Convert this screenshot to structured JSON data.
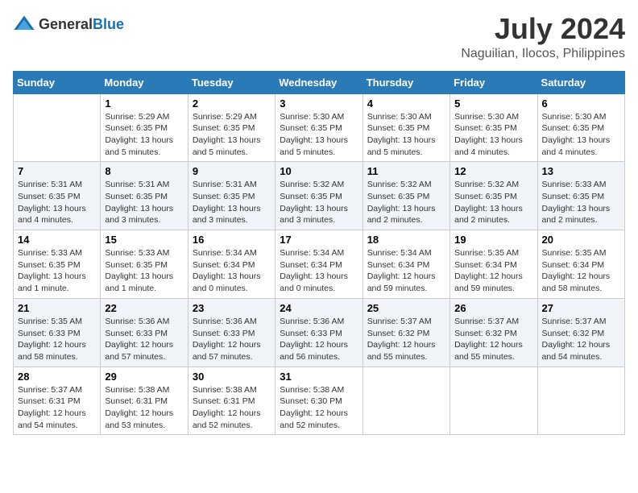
{
  "header": {
    "logo_general": "General",
    "logo_blue": "Blue",
    "month": "July 2024",
    "location": "Naguilian, Ilocos, Philippines"
  },
  "columns": [
    "Sunday",
    "Monday",
    "Tuesday",
    "Wednesday",
    "Thursday",
    "Friday",
    "Saturday"
  ],
  "weeks": [
    [
      {
        "day": "",
        "sunrise": "",
        "sunset": "",
        "daylight": ""
      },
      {
        "day": "1",
        "sunrise": "Sunrise: 5:29 AM",
        "sunset": "Sunset: 6:35 PM",
        "daylight": "Daylight: 13 hours and 5 minutes."
      },
      {
        "day": "2",
        "sunrise": "Sunrise: 5:29 AM",
        "sunset": "Sunset: 6:35 PM",
        "daylight": "Daylight: 13 hours and 5 minutes."
      },
      {
        "day": "3",
        "sunrise": "Sunrise: 5:30 AM",
        "sunset": "Sunset: 6:35 PM",
        "daylight": "Daylight: 13 hours and 5 minutes."
      },
      {
        "day": "4",
        "sunrise": "Sunrise: 5:30 AM",
        "sunset": "Sunset: 6:35 PM",
        "daylight": "Daylight: 13 hours and 5 minutes."
      },
      {
        "day": "5",
        "sunrise": "Sunrise: 5:30 AM",
        "sunset": "Sunset: 6:35 PM",
        "daylight": "Daylight: 13 hours and 4 minutes."
      },
      {
        "day": "6",
        "sunrise": "Sunrise: 5:30 AM",
        "sunset": "Sunset: 6:35 PM",
        "daylight": "Daylight: 13 hours and 4 minutes."
      }
    ],
    [
      {
        "day": "7",
        "sunrise": "Sunrise: 5:31 AM",
        "sunset": "Sunset: 6:35 PM",
        "daylight": "Daylight: 13 hours and 4 minutes."
      },
      {
        "day": "8",
        "sunrise": "Sunrise: 5:31 AM",
        "sunset": "Sunset: 6:35 PM",
        "daylight": "Daylight: 13 hours and 3 minutes."
      },
      {
        "day": "9",
        "sunrise": "Sunrise: 5:31 AM",
        "sunset": "Sunset: 6:35 PM",
        "daylight": "Daylight: 13 hours and 3 minutes."
      },
      {
        "day": "10",
        "sunrise": "Sunrise: 5:32 AM",
        "sunset": "Sunset: 6:35 PM",
        "daylight": "Daylight: 13 hours and 3 minutes."
      },
      {
        "day": "11",
        "sunrise": "Sunrise: 5:32 AM",
        "sunset": "Sunset: 6:35 PM",
        "daylight": "Daylight: 13 hours and 2 minutes."
      },
      {
        "day": "12",
        "sunrise": "Sunrise: 5:32 AM",
        "sunset": "Sunset: 6:35 PM",
        "daylight": "Daylight: 13 hours and 2 minutes."
      },
      {
        "day": "13",
        "sunrise": "Sunrise: 5:33 AM",
        "sunset": "Sunset: 6:35 PM",
        "daylight": "Daylight: 13 hours and 2 minutes."
      }
    ],
    [
      {
        "day": "14",
        "sunrise": "Sunrise: 5:33 AM",
        "sunset": "Sunset: 6:35 PM",
        "daylight": "Daylight: 13 hours and 1 minute."
      },
      {
        "day": "15",
        "sunrise": "Sunrise: 5:33 AM",
        "sunset": "Sunset: 6:35 PM",
        "daylight": "Daylight: 13 hours and 1 minute."
      },
      {
        "day": "16",
        "sunrise": "Sunrise: 5:34 AM",
        "sunset": "Sunset: 6:34 PM",
        "daylight": "Daylight: 13 hours and 0 minutes."
      },
      {
        "day": "17",
        "sunrise": "Sunrise: 5:34 AM",
        "sunset": "Sunset: 6:34 PM",
        "daylight": "Daylight: 13 hours and 0 minutes."
      },
      {
        "day": "18",
        "sunrise": "Sunrise: 5:34 AM",
        "sunset": "Sunset: 6:34 PM",
        "daylight": "Daylight: 12 hours and 59 minutes."
      },
      {
        "day": "19",
        "sunrise": "Sunrise: 5:35 AM",
        "sunset": "Sunset: 6:34 PM",
        "daylight": "Daylight: 12 hours and 59 minutes."
      },
      {
        "day": "20",
        "sunrise": "Sunrise: 5:35 AM",
        "sunset": "Sunset: 6:34 PM",
        "daylight": "Daylight: 12 hours and 58 minutes."
      }
    ],
    [
      {
        "day": "21",
        "sunrise": "Sunrise: 5:35 AM",
        "sunset": "Sunset: 6:33 PM",
        "daylight": "Daylight: 12 hours and 58 minutes."
      },
      {
        "day": "22",
        "sunrise": "Sunrise: 5:36 AM",
        "sunset": "Sunset: 6:33 PM",
        "daylight": "Daylight: 12 hours and 57 minutes."
      },
      {
        "day": "23",
        "sunrise": "Sunrise: 5:36 AM",
        "sunset": "Sunset: 6:33 PM",
        "daylight": "Daylight: 12 hours and 57 minutes."
      },
      {
        "day": "24",
        "sunrise": "Sunrise: 5:36 AM",
        "sunset": "Sunset: 6:33 PM",
        "daylight": "Daylight: 12 hours and 56 minutes."
      },
      {
        "day": "25",
        "sunrise": "Sunrise: 5:37 AM",
        "sunset": "Sunset: 6:32 PM",
        "daylight": "Daylight: 12 hours and 55 minutes."
      },
      {
        "day": "26",
        "sunrise": "Sunrise: 5:37 AM",
        "sunset": "Sunset: 6:32 PM",
        "daylight": "Daylight: 12 hours and 55 minutes."
      },
      {
        "day": "27",
        "sunrise": "Sunrise: 5:37 AM",
        "sunset": "Sunset: 6:32 PM",
        "daylight": "Daylight: 12 hours and 54 minutes."
      }
    ],
    [
      {
        "day": "28",
        "sunrise": "Sunrise: 5:37 AM",
        "sunset": "Sunset: 6:31 PM",
        "daylight": "Daylight: 12 hours and 54 minutes."
      },
      {
        "day": "29",
        "sunrise": "Sunrise: 5:38 AM",
        "sunset": "Sunset: 6:31 PM",
        "daylight": "Daylight: 12 hours and 53 minutes."
      },
      {
        "day": "30",
        "sunrise": "Sunrise: 5:38 AM",
        "sunset": "Sunset: 6:31 PM",
        "daylight": "Daylight: 12 hours and 52 minutes."
      },
      {
        "day": "31",
        "sunrise": "Sunrise: 5:38 AM",
        "sunset": "Sunset: 6:30 PM",
        "daylight": "Daylight: 12 hours and 52 minutes."
      },
      {
        "day": "",
        "sunrise": "",
        "sunset": "",
        "daylight": ""
      },
      {
        "day": "",
        "sunrise": "",
        "sunset": "",
        "daylight": ""
      },
      {
        "day": "",
        "sunrise": "",
        "sunset": "",
        "daylight": ""
      }
    ]
  ]
}
